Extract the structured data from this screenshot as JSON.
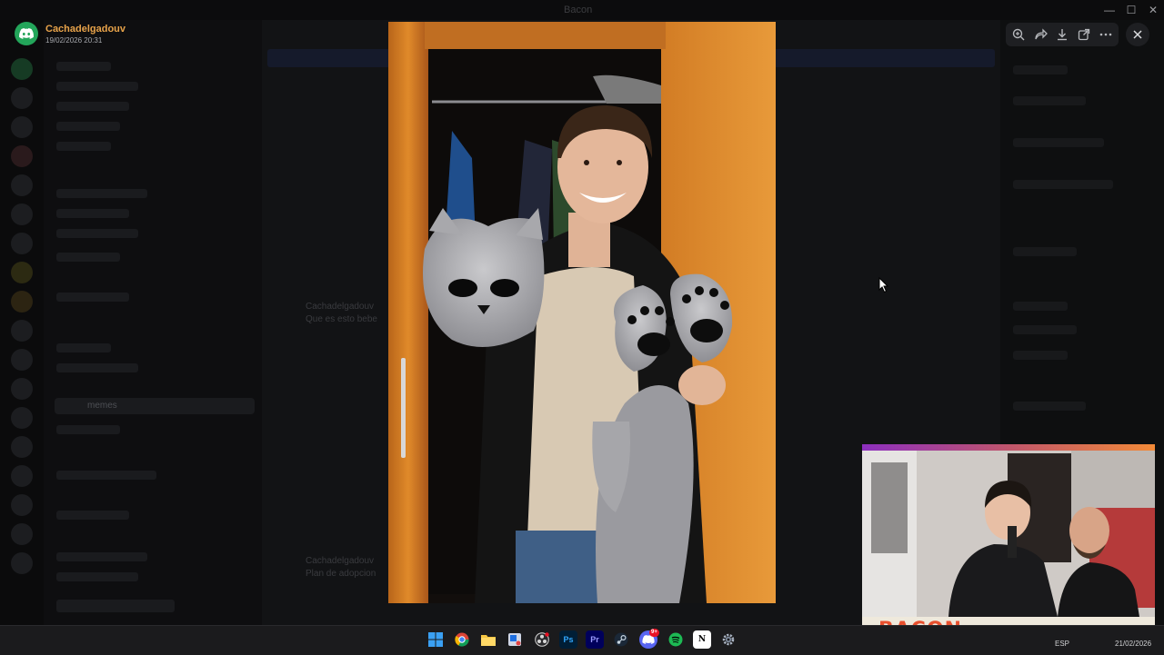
{
  "window": {
    "title": "Bacon",
    "controls": {
      "minimize": "—",
      "maximize": "☐",
      "close": "✕"
    }
  },
  "viewer": {
    "uploader_name": "Cachadelgadouv",
    "upload_time": "19/02/2026 20:31",
    "toolbar_icons": [
      "zoom-in-icon",
      "forward-icon",
      "download-icon",
      "open-external-icon",
      "more-icon"
    ],
    "close_icon": "close-icon"
  },
  "background": {
    "selected_channel": "memes",
    "chat_author": "Cachadelgadouv",
    "chat_message": "Que es esto bebe",
    "chat_author_2": "Cachadelgadouv",
    "chat_message_2": "Plan de adopcion"
  },
  "webcam": {
    "brand_text": "BACON"
  },
  "taskbar": {
    "apps": [
      "windows-start-icon",
      "chrome-icon",
      "file-explorer-icon",
      "snipping-tool-icon",
      "obs-icon",
      "photoshop-icon",
      "premiere-icon",
      "steam-icon",
      "discord-icon",
      "spotify-icon",
      "notion-icon",
      "settings-icon"
    ],
    "labels": {
      "photoshop": "Ps",
      "premiere": "Pr",
      "notion": "N"
    },
    "discord_badge": "9+",
    "tray_text": "ESP",
    "tray_date": "21/02/2026"
  },
  "colors": {
    "accent_orange": "#e8a34a",
    "discord_green": "#23a55a",
    "brand_red": "#e8502e"
  }
}
